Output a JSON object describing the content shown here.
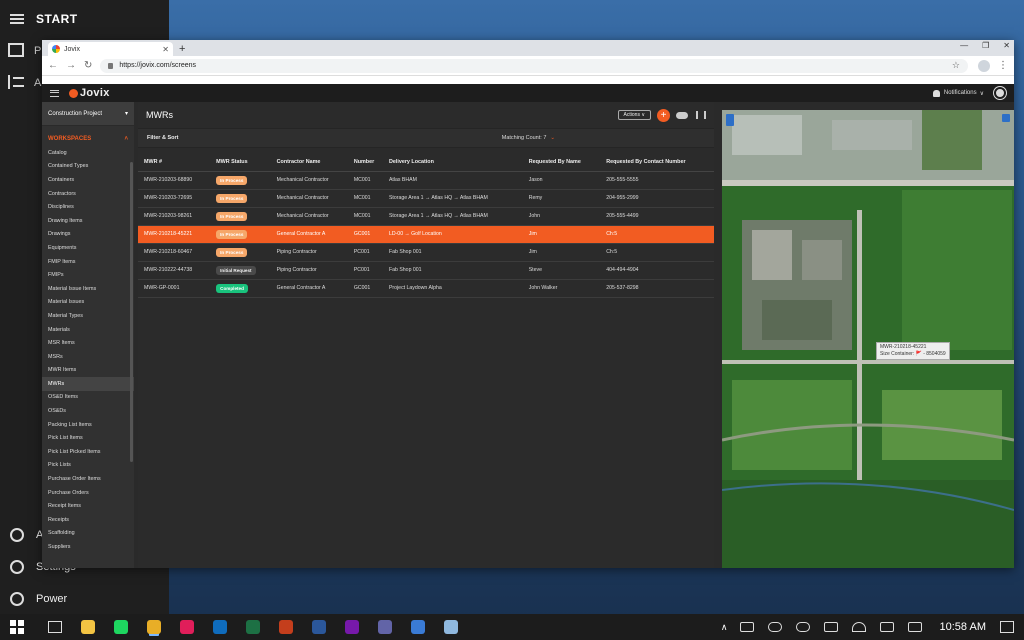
{
  "start": {
    "title": "START",
    "rail_letters": [
      "P",
      "A"
    ],
    "account_letter": "A",
    "settings_label": "Settings",
    "power_label": "Power"
  },
  "browser": {
    "tab_title": "Jovix",
    "new_tab": "+",
    "url": "https://jovix.com/screens",
    "window_controls": [
      "—",
      "❐",
      "✕"
    ]
  },
  "app": {
    "logo": "Jovix",
    "notifications_label": "Notifications",
    "project": "Construction Project",
    "workspaces_label": "WORKSPACES",
    "sidebar_items": [
      "Catalog",
      "Contained Types",
      "Containers",
      "Contractors",
      "Disciplines",
      "Drawing Items",
      "Drawings",
      "Equipments",
      "FMIP Items",
      "FMIPs",
      "Material Issue Items",
      "Material Issues",
      "Material Types",
      "Materials",
      "MSR Items",
      "MSRs",
      "MWR Items",
      "MWRs",
      "OS&D Items",
      "OS&Ds",
      "Packing List Items",
      "Pick List Items",
      "Pick List Picked Items",
      "Pick Lists",
      "Purchase Order Items",
      "Purchase Orders",
      "Receipt Items",
      "Receipts",
      "Scaffolding",
      "Suppliers"
    ],
    "active_sidebar_index": 17,
    "page_title": "MWRs",
    "actions_label": "Actions ∨",
    "add_label": "+",
    "filter_label": "Filter & Sort",
    "matching_count": "Matching Count: 7",
    "columns": [
      "MWR #",
      "MWR Status",
      "Contractor Name",
      "Number",
      "Delivery Location",
      "Requested By Name",
      "Requested By Contact Number"
    ],
    "rows": [
      {
        "mwr": "MWR-210203-68890",
        "status": "In Process",
        "status_type": "in-progress",
        "contractor": "Mechanical Contractor",
        "number": "MC001",
        "location": "Atlas BHAM",
        "name": "Jason",
        "contact": "205-555-5555"
      },
      {
        "mwr": "MWR-210203-72695",
        "status": "In Process",
        "status_type": "in-progress",
        "contractor": "Mechanical Contractor",
        "number": "MC001",
        "location": "Storage Area 1 → Atlas HQ → Atlas BHAM",
        "name": "Remy",
        "contact": "204-955-2999"
      },
      {
        "mwr": "MWR-210203-98261",
        "status": "In Process",
        "status_type": "in-progress",
        "contractor": "Mechanical Contractor",
        "number": "MC001",
        "location": "Storage Area 1 → Atlas HQ → Atlas BHAM",
        "name": "John",
        "contact": "205-555-4499"
      },
      {
        "mwr": "MWR-210218-45221",
        "status": "In Process",
        "status_type": "in-progress",
        "contractor": "General Contractor A",
        "number": "GC001",
        "location": "LD-00 → Golf Location",
        "name": "Jim",
        "contact": "Ch:5",
        "highlight": true
      },
      {
        "mwr": "MWR-210218-60467",
        "status": "In Process",
        "status_type": "in-progress",
        "contractor": "Piping Contractor",
        "number": "PC001",
        "location": "Fab Shop 001",
        "name": "Jim",
        "contact": "Ch:5"
      },
      {
        "mwr": "MWR-210222-44738",
        "status": "Initial Request",
        "status_type": "initial",
        "contractor": "Piping Contractor",
        "number": "PC001",
        "location": "Fab Shop 001",
        "name": "Steve",
        "contact": "404-494-4904"
      },
      {
        "mwr": "MWR-GP-0001",
        "status": "Completed",
        "status_type": "completed",
        "contractor": "General Contractor A",
        "number": "GC001",
        "location": "Project Laydown Alpha",
        "name": "John Walker",
        "contact": "205-537-8298"
      }
    ],
    "map_popup": [
      "MWR-210218-45221",
      "Size Container: 🚩 - 8504059"
    ]
  },
  "taskbar": {
    "time": "10:58 AM",
    "apps": [
      {
        "name": "file-explorer",
        "color": "#f3c443"
      },
      {
        "name": "spotify",
        "color": "#1ed760"
      },
      {
        "name": "chrome",
        "color": "#e8ae27",
        "active": true
      },
      {
        "name": "slack",
        "color": "#e01e5a"
      },
      {
        "name": "outlook",
        "color": "#0f6cbd"
      },
      {
        "name": "excel",
        "color": "#1d7044"
      },
      {
        "name": "powerpoint",
        "color": "#c43e1c"
      },
      {
        "name": "word",
        "color": "#2b579a"
      },
      {
        "name": "onenote",
        "color": "#7719aa"
      },
      {
        "name": "teams",
        "color": "#6264a7"
      },
      {
        "name": "photos",
        "color": "#3a7bd5"
      },
      {
        "name": "paint",
        "color": "#8fb8de"
      }
    ]
  }
}
